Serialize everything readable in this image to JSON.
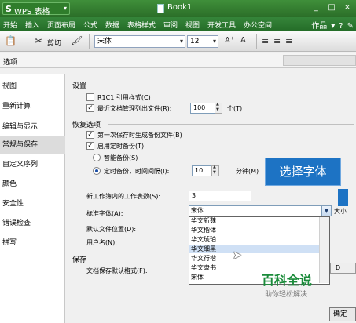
{
  "app": {
    "logo_letter": "S",
    "name": "WPS 表格",
    "document_title": "Book1"
  },
  "window_controls": [
    "_",
    "□",
    "×"
  ],
  "menu": {
    "items": [
      "开始",
      "插入",
      "页面布局",
      "公式",
      "数据",
      "表格样式",
      "审阅",
      "视图",
      "开发工具",
      "办公空间"
    ],
    "right_label": "作品",
    "right_icons": [
      "▾",
      "?",
      "✎"
    ]
  },
  "toolbar": {
    "cut_label": "剪切",
    "font_name": "宋体",
    "font_size": "12",
    "buttons": [
      "A⁺",
      "A⁻",
      "≡",
      "≡",
      "≡"
    ]
  },
  "dialog": {
    "title": "选项",
    "nav": {
      "items": [
        "视图",
        "重新计算",
        "编辑与显示",
        "常规与保存",
        "自定义序列",
        "颜色",
        "安全性",
        "错误检查",
        "拼写"
      ],
      "active": "常规与保存"
    },
    "settings": {
      "title": "设置",
      "r1c1_label": "R1C1 引用样式(C)",
      "r1c1_checked": false,
      "recent_label": "最近文档管理列出文件(R):",
      "recent_checked": true,
      "recent_value": "100",
      "recent_unit": "个(T)"
    },
    "recovery": {
      "title": "恢复选项",
      "first_backup_label": "第一次保存时生成备份文件(B)",
      "first_backup_checked": true,
      "timed_backup_label": "启用定时备份(T)",
      "timed_backup_checked": true,
      "smart_label": "智能备份(S)",
      "interval_label": "定时备份，时间间隔(I):",
      "interval_value": "10",
      "interval_unit": "分钟(M)"
    },
    "general": {
      "sheets_label": "新工作簿内的工作表数(S):",
      "sheets_value": "3",
      "std_font_label": "标准字体(A):",
      "std_font_value": "宋体",
      "size_tail": "大小",
      "location_label": "默认文件位置(D):",
      "username_label": "用户名(N):"
    },
    "save": {
      "title": "保存",
      "format_label": "文档保存默认格式(F):",
      "button_label": "D"
    },
    "font_options": [
      "华文新魏",
      "华文楷体",
      "华文琥珀",
      "华文细黑",
      "华文行楷",
      "华文隶书",
      "宋体"
    ],
    "font_highlight": "华文细黑",
    "ok_label": "确定"
  },
  "callout": {
    "text": "选择字体"
  },
  "watermark": {
    "title": "百科全说",
    "subtitle": "助你轻松解决"
  },
  "colors": {
    "title_bar": "#2f7d2b",
    "callout": "#1d73c4",
    "watermark": "#1a8b3a"
  }
}
